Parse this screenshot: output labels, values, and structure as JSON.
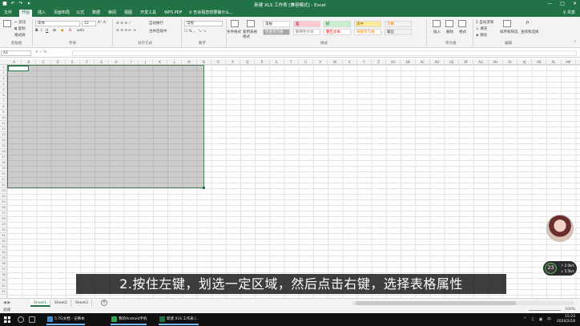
{
  "titlebar": {
    "title": "新建 XLS 工作表 [兼容模式] - Excel",
    "qat_icons": [
      "save-icon",
      "undo-icon",
      "redo-icon",
      "customize-icon"
    ],
    "window_buttons": [
      "—",
      "□",
      "✕"
    ],
    "color": "#217346"
  },
  "tabs": {
    "items": [
      "文件",
      "开始",
      "插入",
      "页面布局",
      "公式",
      "数据",
      "审阅",
      "视图",
      "开发工具",
      "WPS PDF"
    ],
    "active": "开始",
    "tell_me": "♀ 告诉我您想要做什么...",
    "share": "♀ 共享"
  },
  "ribbon": {
    "clipboard": {
      "cut": "✂ 剪切",
      "copy": "⧉ 复制",
      "format_painter": "格式刷",
      "label": "剪贴板"
    },
    "font": {
      "name": "宋体",
      "size": "12",
      "label": "字体"
    },
    "alignment": {
      "wrap": "自动换行",
      "merge": "合并后居中",
      "label": "对齐方式"
    },
    "number": {
      "format": "常规",
      "label": "数字"
    },
    "styles": {
      "conditional": "条件格式",
      "table_format": "套用表格格式",
      "cells": [
        {
          "text": "常规",
          "bg": "#ffffff",
          "fg": "#333333"
        },
        {
          "text": "差",
          "bg": "#ffc7ce",
          "fg": "#9c0006"
        },
        {
          "text": "好",
          "bg": "#c6efce",
          "fg": "#006100"
        },
        {
          "text": "适中",
          "bg": "#ffeb9c",
          "fg": "#9c5700"
        },
        {
          "text": "计算",
          "bg": "#f2f2f2",
          "fg": "#fa7d00"
        },
        {
          "text": "检查单元格",
          "bg": "#a5a5a5",
          "fg": "#ffffff"
        },
        {
          "text": "解释性文本",
          "bg": "#ffffff",
          "fg": "#7f7f7f"
        },
        {
          "text": "警告文本",
          "bg": "#ffffff",
          "fg": "#ff0000"
        },
        {
          "text": "链接单元格",
          "bg": "#ffffff",
          "fg": "#fa7d00"
        },
        {
          "text": "输出",
          "bg": "#f2f2f2",
          "fg": "#3f3f3f"
        }
      ],
      "label": "样式"
    },
    "cells": {
      "insert": "插入",
      "delete": "删除",
      "format": "格式",
      "label": "单元格"
    },
    "editing": {
      "autosum": "Σ 自动求和",
      "fill": "↓ 填充",
      "clear": "◈ 清除",
      "sort": "排序和筛选",
      "find": "查找和选择",
      "label": "编辑"
    }
  },
  "formula_bar": {
    "name_box": "A1",
    "fx": "✕  ✓  fx",
    "value": ""
  },
  "grid": {
    "columns": [
      "A",
      "B",
      "C",
      "D",
      "E",
      "F",
      "G",
      "H",
      "I",
      "J",
      "K",
      "L",
      "M",
      "N",
      "O",
      "P",
      "Q",
      "R",
      "S",
      "T",
      "U",
      "V",
      "W",
      "X",
      "Y",
      "Z",
      "AA",
      "AB",
      "AC",
      "AD",
      "AE",
      "AF",
      "AG",
      "AH",
      "AI",
      "AJ",
      "AK",
      "AL",
      "AM"
    ],
    "rows": [
      "1",
      "2",
      "3",
      "4",
      "5",
      "6",
      "7",
      "8",
      "9",
      "10",
      "11",
      "12",
      "13",
      "14",
      "15",
      "16",
      "17",
      "18",
      "19",
      "20",
      "21",
      "22",
      "23",
      "24",
      "25",
      "26",
      "27",
      "28",
      "29",
      "30",
      "31",
      "32",
      "33",
      "34",
      "35",
      "36",
      "37",
      "38",
      "39",
      "40",
      "41"
    ]
  },
  "subtitle": "2.按住左键，划选一定区域，然后点击右键，选择表格属性",
  "speed_widget": {
    "percent": "23",
    "up": "↑ 2.0k/s",
    "down": "↓ 5.5k/s"
  },
  "sheets": {
    "tabs": [
      "Sheet1",
      "Sheet2",
      "Sheet3"
    ],
    "active": "Sheet1",
    "add": "+"
  },
  "status": {
    "ready": "就绪",
    "zoom": "100%"
  },
  "taskbar": {
    "tasks": [
      {
        "label": "5.7G文档 - 记事本",
        "color": "#3b8fd6"
      },
      {
        "label": "我的Android手机",
        "color": "#2fa84f"
      },
      {
        "label": "新建 XLS 工作表 [..",
        "color": "#217346"
      }
    ],
    "time": "15:23",
    "date": "2020/2/18",
    "tray": "^ ♫ ▣ 中"
  }
}
